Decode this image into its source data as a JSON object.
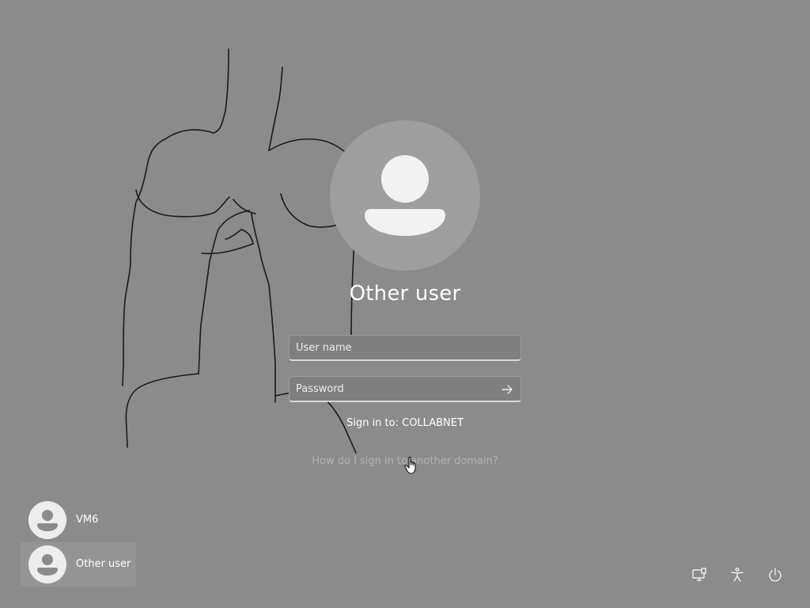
{
  "login": {
    "selected_user": "Other user",
    "username_placeholder": "User name",
    "password_placeholder": "Password",
    "sign_in_to": "Sign in to: COLLABNET",
    "help_link": "How do I sign in to another domain?"
  },
  "users": [
    {
      "label": "VM6",
      "selected": false
    },
    {
      "label": "Other user",
      "selected": true
    }
  ],
  "tray": {
    "icons": [
      "network-icon",
      "accessibility-icon",
      "power-icon"
    ]
  },
  "colors": {
    "background": "#8b8b8b",
    "avatar_circle": "#9e9e9e",
    "avatar_figure": "#f2f2f2",
    "text": "#ffffff",
    "link_muted": "#b3b3b3"
  }
}
